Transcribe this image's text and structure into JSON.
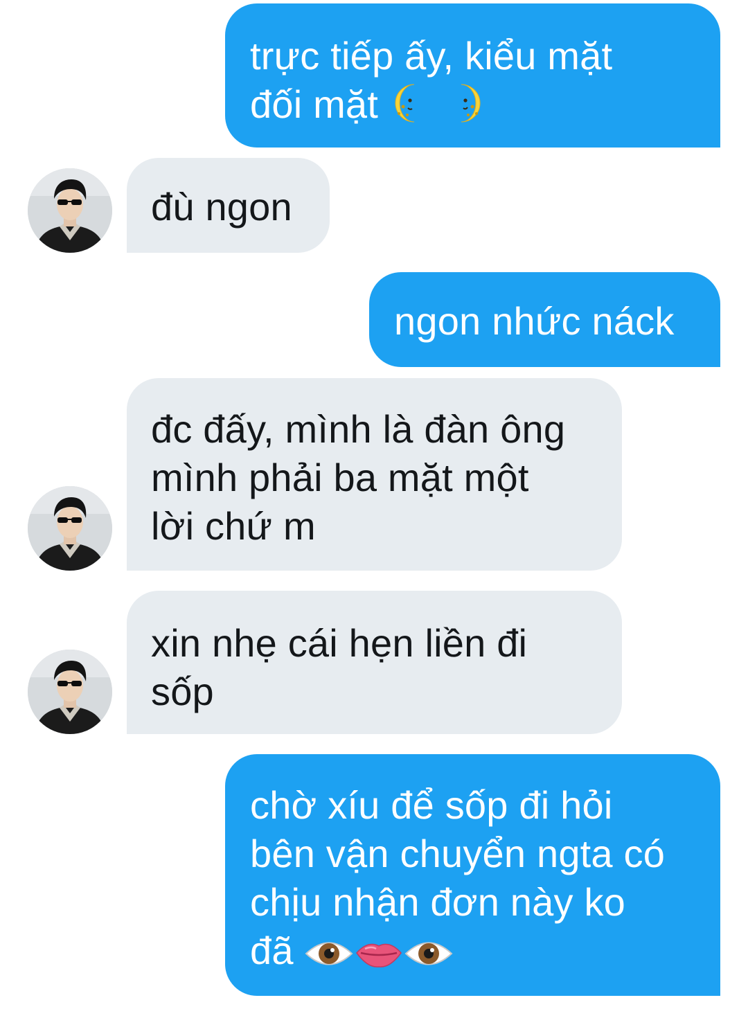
{
  "messages": [
    {
      "direction": "sent",
      "lines": [
        "trực tiếp ấy, kiểu mặt",
        "đối mặt"
      ],
      "emoji": [
        "moon-face-first-quarter",
        "moon-face-last-quarter"
      ]
    },
    {
      "direction": "received",
      "lines": [
        "đù ngon"
      ]
    },
    {
      "direction": "sent",
      "lines": [
        "ngon nhức náck"
      ]
    },
    {
      "direction": "received",
      "lines": [
        "đc đấy, mình là đàn ông",
        "mình phải ba mặt một",
        "lời chứ m"
      ]
    },
    {
      "direction": "received",
      "lines": [
        "xin nhẹ cái hẹn liền đi",
        "sốp"
      ]
    },
    {
      "direction": "sent",
      "lines": [
        "chờ xíu để sốp đi hỏi",
        "bên vận chuyển ngta có",
        "chịu nhận đơn này ko",
        "đã"
      ],
      "emoji": [
        "eye",
        "mouth",
        "eye"
      ]
    }
  ],
  "colors": {
    "sent_bubble": "#1da1f2",
    "received_bubble": "#e7ecf0",
    "sent_text": "#ffffff",
    "received_text": "#14171a"
  }
}
